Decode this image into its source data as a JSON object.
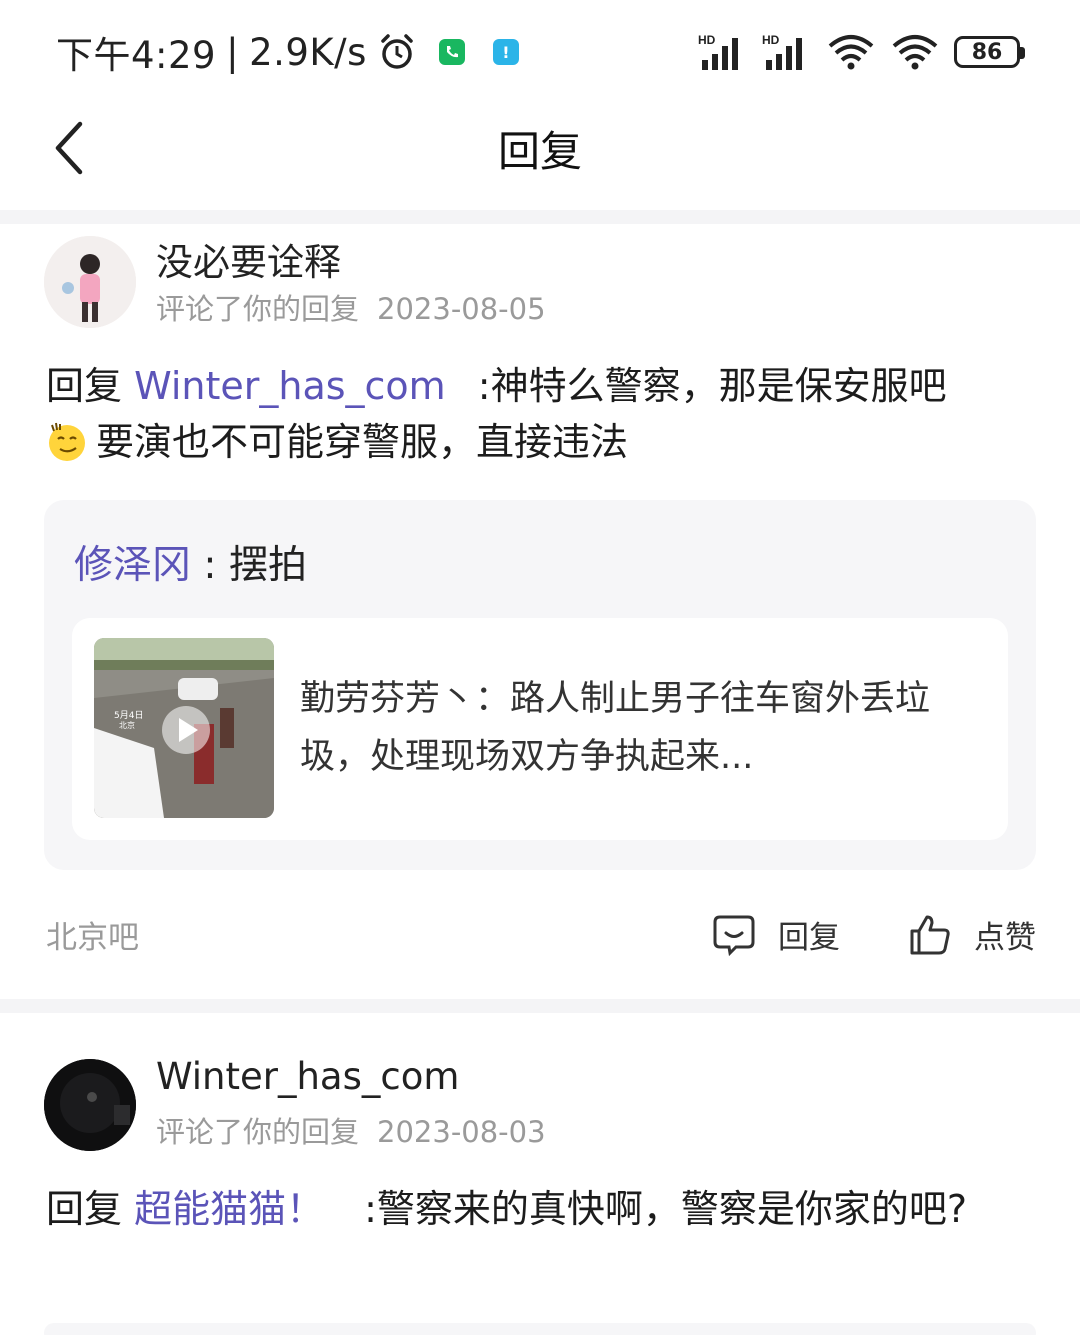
{
  "status_bar": {
    "time": "下午4:29",
    "separator": "|",
    "speed": "2.9K/s",
    "battery": "86",
    "signal_badge_1": "HD",
    "signal_badge_2": "HD"
  },
  "nav": {
    "title": "回复"
  },
  "comments": [
    {
      "username": "没必要诠释",
      "action_text": "评论了你的回复",
      "date": "2023-08-05",
      "reply_prefix": "回复 ",
      "reply_target": "Winter_has_com",
      "content_line1": ":神特么警察，那是保安服吧",
      "content_line2": "要演也不可能穿警服，直接违法",
      "quote": {
        "author": "修泽冈",
        "separator": " : ",
        "text": "摆拍",
        "inner_text": "勤劳芬芳丶：路人制止男子往车窗外丢垃圾，处理现场双方争执起来...",
        "thumb_label": "5月4日\n北京"
      },
      "forum": "北京吧",
      "reply_label": "回复",
      "like_label": "点赞"
    },
    {
      "username": "Winter_has_com",
      "action_text": "评论了你的回复",
      "date": "2023-08-03",
      "reply_prefix": "回复 ",
      "reply_target": "超能猫猫！",
      "content_line1": ":警察来的真快啊，警察是你家的吧?"
    }
  ],
  "colors": {
    "link": "#5b54b8",
    "meta": "#9a9a9a",
    "band": "#f4f4f6",
    "quote_bg": "#f6f6f8"
  }
}
